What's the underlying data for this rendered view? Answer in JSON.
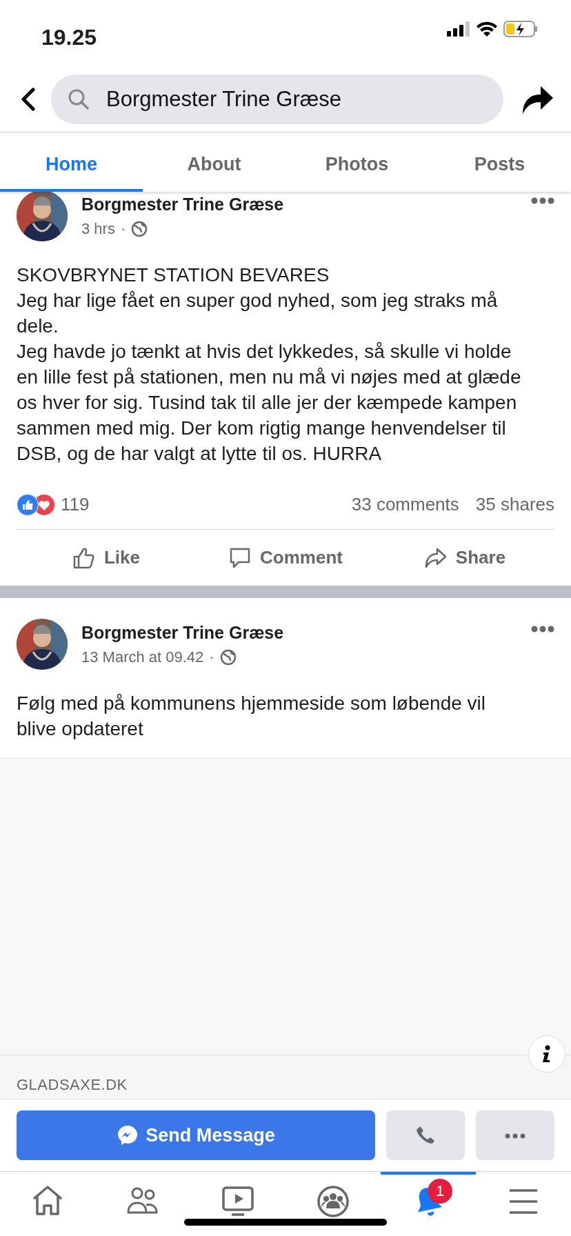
{
  "status_bar": {
    "time": "19.25"
  },
  "search": {
    "value": "Borgmester Trine Græse"
  },
  "tabs": [
    {
      "label": "Home",
      "selected": true
    },
    {
      "label": "About",
      "selected": false
    },
    {
      "label": "Photos",
      "selected": false
    },
    {
      "label": "Posts",
      "selected": false
    }
  ],
  "posts": [
    {
      "author": "Borgmester Trine Græse",
      "time": "3 hrs",
      "separator": "·",
      "paragraphs": [
        "SKOVBRYNET STATION BEVARES",
        "Jeg har lige fået en super god nyhed, som jeg straks må dele.",
        "Jeg havde jo tænkt at hvis det lykkedes, så skulle vi holde en lille fest på stationen, men nu må vi nøjes med at glæde os hver for sig. Tusind tak til alle jer der kæmpede kampen sammen med mig. Der kom rigtig mange henvendelser til DSB, og de har valgt at lytte til os. HURRA"
      ],
      "reactions": "119",
      "comments": "33 comments",
      "shares": "35 shares",
      "actions": [
        "Like",
        "Comment",
        "Share"
      ]
    },
    {
      "author": "Borgmester Trine Græse",
      "time": "13 March at 09.42",
      "separator": "·",
      "paragraphs": [
        "Følg med på kommunens hjemmeside som løbende vil blive opdateret"
      ],
      "link": {
        "domain": "GLADSAXE.DK"
      }
    }
  ],
  "action_bar": {
    "message": "Send Message"
  },
  "bottom_nav": [
    {
      "kind": "home",
      "selected": false
    },
    {
      "kind": "friends",
      "selected": false
    },
    {
      "kind": "watch",
      "selected": false
    },
    {
      "kind": "groups",
      "selected": false
    },
    {
      "kind": "notifications",
      "selected": true,
      "badge": "1"
    },
    {
      "kind": "menu",
      "selected": false
    }
  ]
}
